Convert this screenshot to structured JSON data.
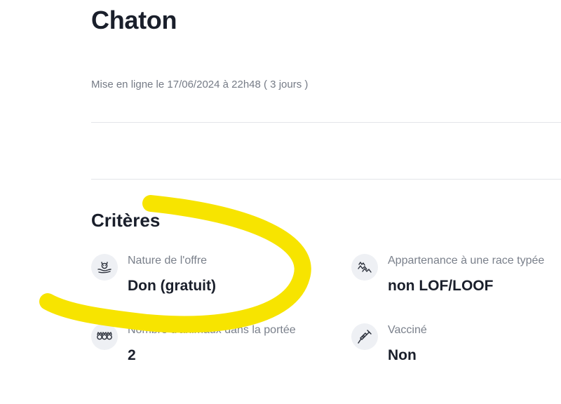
{
  "listing": {
    "title": "Chaton",
    "posted": "Mise en ligne le 17/06/2024 à 22h48 ( 3 jours )"
  },
  "criteria": {
    "heading": "Critères",
    "items": [
      {
        "label": "Nature de l'offre",
        "value": "Don (gratuit)",
        "icon": "cat-in-hand-icon"
      },
      {
        "label": "Appartenance à une race typée",
        "value": "non LOF/LOOF",
        "icon": "breed-icon"
      },
      {
        "label": "Nombre d'animaux dans la portée",
        "value": "2",
        "icon": "litter-icon"
      },
      {
        "label": "Vacciné",
        "value": "Non",
        "icon": "syringe-icon"
      }
    ]
  },
  "colors": {
    "highlight": "#f7e400",
    "icon_bg": "#eef0f4",
    "text_dark": "#1a1f2b",
    "text_muted": "#7a808b"
  }
}
